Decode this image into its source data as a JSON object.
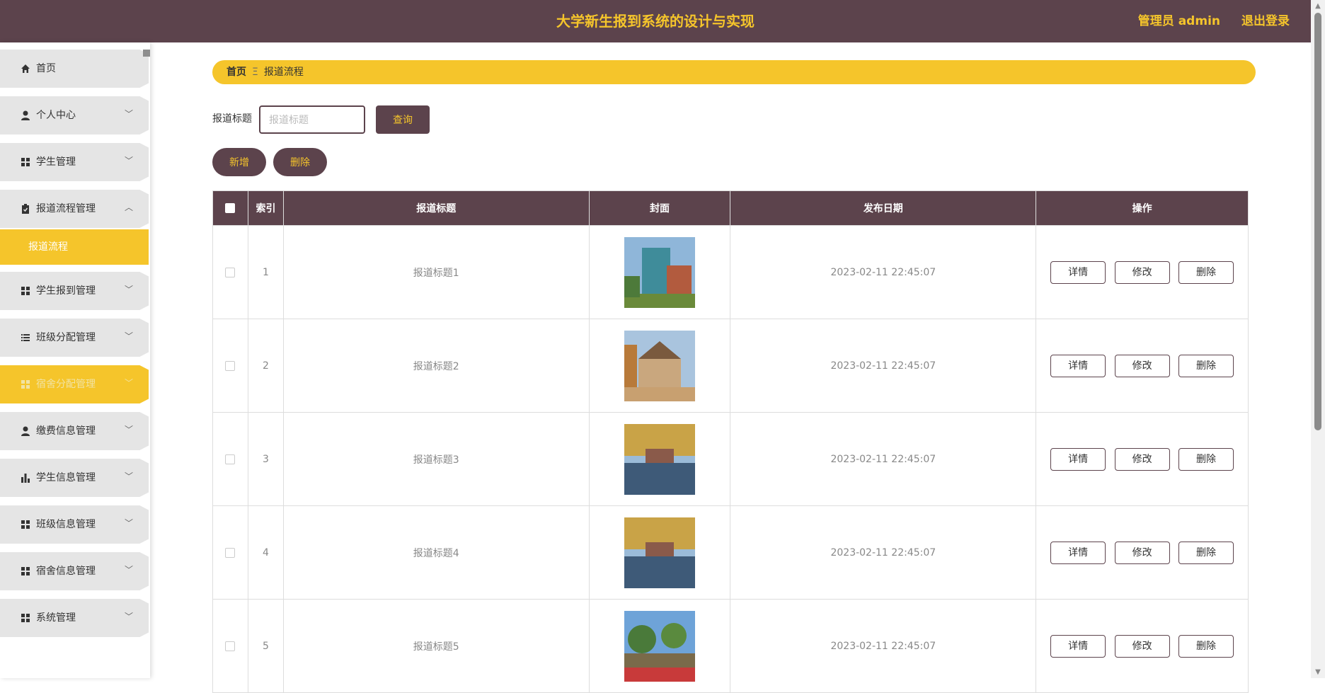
{
  "header": {
    "title": "大学新生报到系统的设计与实现",
    "user": "管理员 admin",
    "logout": "退出登录"
  },
  "sidebar": {
    "items": [
      {
        "label": "首页",
        "icon": "home-icon"
      },
      {
        "label": "个人中心",
        "icon": "user-icon"
      },
      {
        "label": "学生管理",
        "icon": "grid-icon"
      },
      {
        "label": "报道流程管理",
        "icon": "clipboard-icon"
      },
      {
        "label": "学生报到管理",
        "icon": "grid-icon"
      },
      {
        "label": "班级分配管理",
        "icon": "list-icon"
      },
      {
        "label": "宿舍分配管理",
        "icon": "grid-icon"
      },
      {
        "label": "缴费信息管理",
        "icon": "user-icon"
      },
      {
        "label": "学生信息管理",
        "icon": "bar-chart-icon"
      },
      {
        "label": "班级信息管理",
        "icon": "grid-icon"
      },
      {
        "label": "宿舍信息管理",
        "icon": "grid-icon"
      },
      {
        "label": "系统管理",
        "icon": "grid-icon"
      }
    ],
    "submenu_label": "报道流程"
  },
  "breadcrumb": {
    "home": "首页",
    "separator": "Ξ",
    "current": "报道流程"
  },
  "search": {
    "label": "报道标题",
    "placeholder": "报道标题",
    "query_label": "查询"
  },
  "actions": {
    "add_label": "新增",
    "delete_label": "删除"
  },
  "table": {
    "headers": [
      "索引",
      "报道标题",
      "封面",
      "发布日期",
      "操作"
    ],
    "rows": [
      {
        "index": "1",
        "title": "报道标题1",
        "date": "2023-02-11 22:45:07"
      },
      {
        "index": "2",
        "title": "报道标题2",
        "date": "2023-02-11 22:45:07"
      },
      {
        "index": "3",
        "title": "报道标题3",
        "date": "2023-02-11 22:45:07"
      },
      {
        "index": "4",
        "title": "报道标题4",
        "date": "2023-02-11 22:45:07"
      },
      {
        "index": "5",
        "title": "报道标题5",
        "date": "2023-02-11 22:45:07"
      }
    ],
    "op_labels": {
      "detail": "详情",
      "edit": "修改",
      "delete": "删除"
    }
  },
  "colors": {
    "primary": "#5c434c",
    "accent": "#f5c52b"
  }
}
